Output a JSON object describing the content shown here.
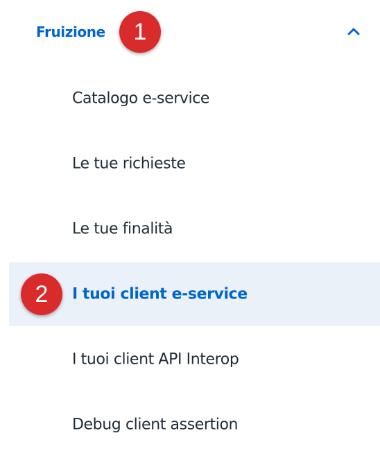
{
  "section": {
    "title": "Fruizione",
    "toggle_icon": "chevron-up-icon",
    "accent_color": "#0066cc"
  },
  "items": [
    {
      "label": "Catalogo e-service"
    },
    {
      "label": "Le tue richieste"
    },
    {
      "label": "Le tue finalità"
    },
    {
      "label": "I tuoi client e-service",
      "active": true
    },
    {
      "label": "I tuoi client API Interop"
    },
    {
      "label": "Debug client assertion"
    }
  ],
  "annotations": [
    {
      "number": "1",
      "color": "#d92b2b"
    },
    {
      "number": "2",
      "color": "#d92b2b"
    }
  ]
}
